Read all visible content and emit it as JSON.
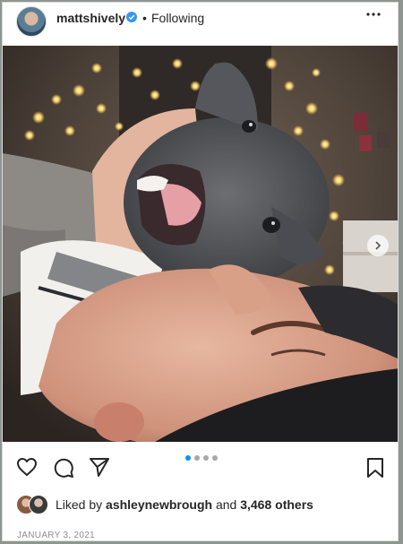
{
  "post": {
    "username": "mattshively",
    "separator": "•",
    "follow_status": "Following",
    "carousel": {
      "slides": 4,
      "active_index": 0
    },
    "likes": {
      "prefix": "Liked by",
      "first_user": "ashleynewbrough",
      "conjunction": "and",
      "others": "3,468 others"
    },
    "date": "JANUARY 3, 2021"
  },
  "icons": {
    "verified": "verified-badge-icon",
    "more": "more-options-icon",
    "like": "heart-icon",
    "comment": "comment-icon",
    "share": "share-icon",
    "save": "bookmark-icon",
    "next": "chevron-right-icon"
  },
  "colors": {
    "verified": "#3897f0",
    "active_dot": "#0095f6",
    "text": "#262626",
    "muted": "#8e8e8e"
  }
}
